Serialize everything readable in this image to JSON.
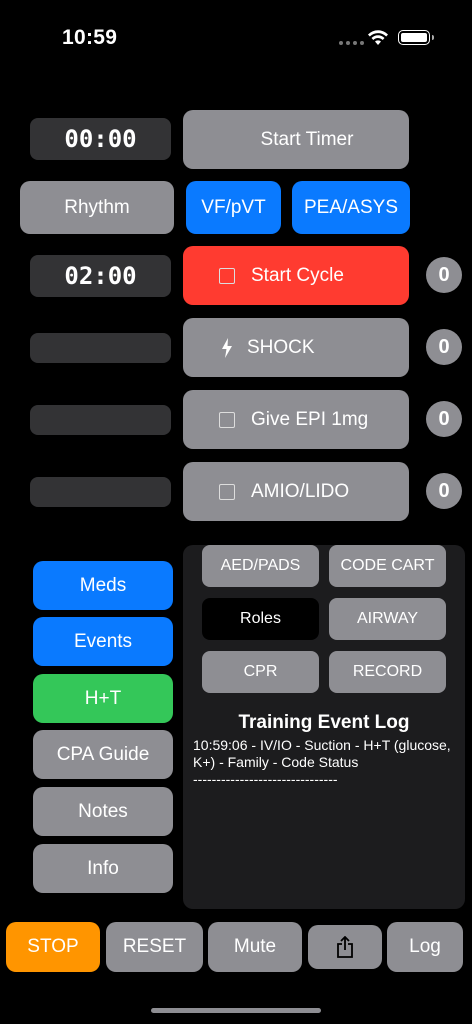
{
  "status_bar": {
    "time": "10:59"
  },
  "timers": {
    "main": "00:00",
    "cycle": "02:00"
  },
  "buttons": {
    "start_timer": "Start Timer",
    "rhythm": "Rhythm",
    "vf": "VF/pVT",
    "pea": "PEA/ASYS"
  },
  "actions": {
    "start_cycle": {
      "label": "Start Cycle",
      "count": "0"
    },
    "shock": {
      "label": "SHOCK",
      "count": "0"
    },
    "epi": {
      "label": "Give EPI 1mg",
      "count": "0"
    },
    "amio": {
      "label": "AMIO/LIDO",
      "count": "0"
    }
  },
  "side_menu": [
    "Meds",
    "Events",
    "H+T",
    "CPA Guide",
    "Notes",
    "Info"
  ],
  "panel": {
    "buttons": [
      "AED/PADS",
      "CODE CART",
      "Roles",
      "AIRWAY",
      "CPR",
      "RECORD"
    ],
    "log_title": "Training Event Log",
    "log_line1": "10:59:06 - IV/IO - Suction - H+T (glucose, K+) - Family - Code Status",
    "log_sep": "-------------------------------"
  },
  "bottom_bar": {
    "stop": "STOP",
    "reset": "RESET",
    "mute": "Mute",
    "log": "Log"
  },
  "colors": {
    "blue": "#0a7aff",
    "red": "#ff3b30",
    "green": "#34c759",
    "orange": "#ff9500",
    "gray": "#8e8e93"
  }
}
